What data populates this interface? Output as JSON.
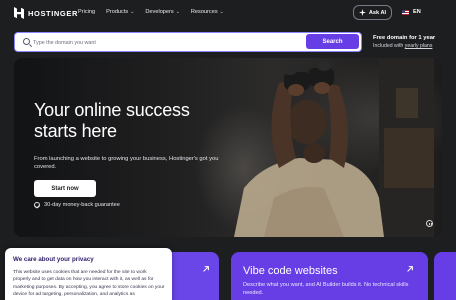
{
  "nav": {
    "logo_text": "HOSTINGER",
    "links": [
      {
        "label": "Pricing",
        "has_menu": false
      },
      {
        "label": "Products",
        "has_menu": true
      },
      {
        "label": "Developers",
        "has_menu": true
      },
      {
        "label": "Resources",
        "has_menu": true
      }
    ],
    "ask_ai_label": "Ask AI",
    "language_label": "EN",
    "icons": {
      "logo": "hostinger-logo",
      "ask_ai": "sparkle-icon",
      "language": "us-flag-icon",
      "menu_chevron": "chevron-down-icon"
    }
  },
  "search": {
    "placeholder": "Type the domain you want",
    "value": "",
    "button_label": "Search",
    "icon": "search-icon"
  },
  "promo": {
    "title": "Free domain for 1 year",
    "subtitle_prefix": "Included with ",
    "subtitle_link": "yearly plans"
  },
  "hero": {
    "title": "Your online success starts here",
    "description": "From launching a website to growing your business, Hostinger's got you covered.",
    "cta_label": "Start now",
    "guarantee": "30-day money-back guarantee",
    "icons": {
      "guarantee": "check-circle-icon",
      "media": "pause-icon"
    }
  },
  "cards": [
    {
      "title": "",
      "description": "",
      "icon": "arrow-up-right-icon"
    },
    {
      "title": "Vibe code websites",
      "description": "Describe what you want, and AI Builder builds it. No technical skills needed.",
      "icon": "arrow-up-right-icon"
    }
  ],
  "cookie": {
    "title": "We care about your privacy",
    "body": "This website uses cookies that are needed for the site to work properly and to get data on how you interact with it, as well as for marketing purposes. By accepting, you agree to store cookies on your device for ad targeting, personalization, and analytics as"
  },
  "colors": {
    "background": "#1d1e20",
    "accent": "#673de6",
    "search_border": "#8c85ff",
    "text": "#ffffff"
  }
}
